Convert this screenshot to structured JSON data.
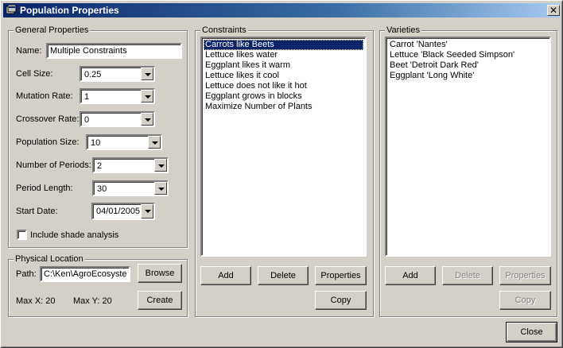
{
  "window": {
    "title": "Population Properties"
  },
  "general": {
    "legend": "General Properties",
    "name_label": "Name:",
    "name_value": "Multiple Constraints",
    "cell_size_label": "Cell Size:",
    "cell_size_value": "0.25",
    "mutation_label": "Mutation Rate:",
    "mutation_value": "1",
    "crossover_label": "Crossover Rate:",
    "crossover_value": "0",
    "pop_size_label": "Population Size:",
    "pop_size_value": "10",
    "periods_label": "Number of Periods:",
    "periods_value": "2",
    "period_length_label": "Period Length:",
    "period_length_value": "30",
    "start_date_label": "Start Date:",
    "start_date_value": "04/01/2005",
    "shade_label": "Include shade analysis",
    "shade_checked": false
  },
  "physical": {
    "legend": "Physical Location",
    "path_label": "Path:",
    "path_value": "C:\\Ken\\AgroEcosyste",
    "browse": "Browse",
    "maxx": "Max X: 20",
    "maxy": "Max Y: 20",
    "create": "Create"
  },
  "constraints": {
    "legend": "Constraints",
    "items": [
      "Carrots like Beets",
      "Lettuce likes water",
      "Eggplant likes it warm",
      "Lettuce likes it cool",
      "Lettuce does not like it hot",
      "Eggplant grows in blocks",
      "Maximize Number of Plants"
    ],
    "selected_index": 0,
    "add": "Add",
    "delete": "Delete",
    "properties": "Properties",
    "copy": "Copy"
  },
  "varieties": {
    "legend": "Varieties",
    "items": [
      "Carrot 'Nantes'",
      "Lettuce 'Black Seeded Simpson'",
      "Beet 'Detroit Dark Red'",
      "Eggplant 'Long White'"
    ],
    "add": "Add",
    "delete": "Delete",
    "properties": "Properties",
    "copy": "Copy"
  },
  "footer": {
    "close": "Close"
  }
}
